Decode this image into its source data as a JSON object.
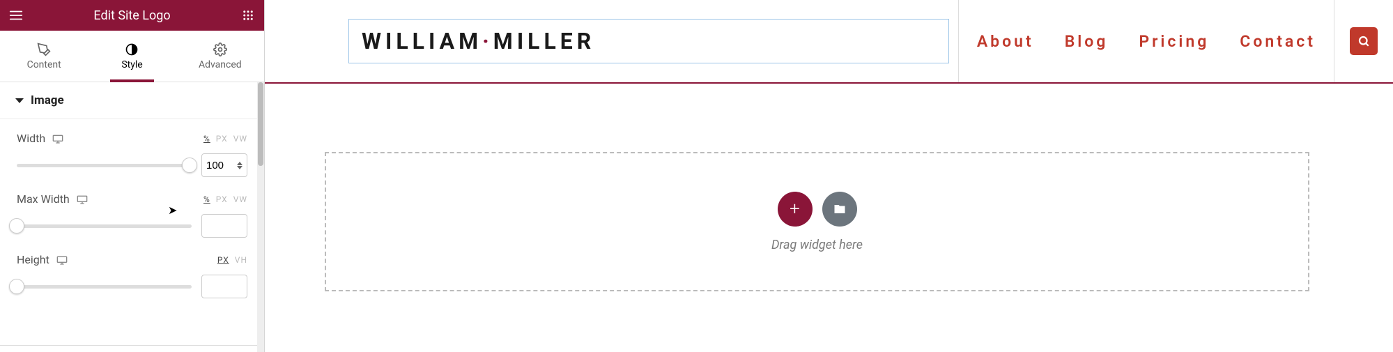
{
  "sidebar": {
    "title": "Edit Site Logo",
    "tabs": {
      "content": "Content",
      "style": "Style",
      "advanced": "Advanced"
    },
    "section": "Image",
    "width": {
      "label": "Width",
      "units": {
        "pct": "%",
        "px": "PX",
        "vw": "VW"
      },
      "value": "100"
    },
    "maxwidth": {
      "label": "Max Width",
      "units": {
        "pct": "%",
        "px": "PX",
        "vw": "VW"
      },
      "value": ""
    },
    "height": {
      "label": "Height",
      "units": {
        "px": "PX",
        "vh": "VH"
      },
      "value": ""
    }
  },
  "header": {
    "logo_first": "WILLIAM",
    "logo_dot": "·",
    "logo_last": "MILLER",
    "nav": {
      "about": "About",
      "blog": "Blog",
      "pricing": "Pricing",
      "contact": "Contact"
    }
  },
  "dropzone": {
    "hint": "Drag widget here",
    "plus": "+"
  }
}
